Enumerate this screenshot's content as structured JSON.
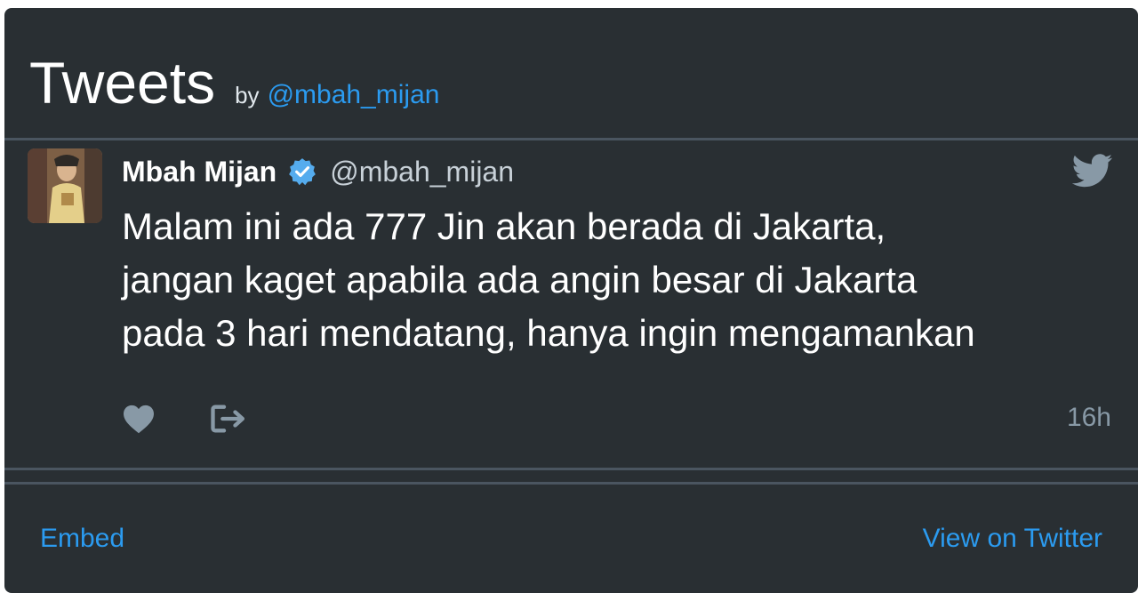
{
  "header": {
    "title": "Tweets",
    "by": "by",
    "handle": "@mbah_mijan"
  },
  "tweet": {
    "display_name": "Mbah Mijan",
    "screen_name": "@mbah_mijan",
    "text_lines": [
      "Malam ini ada 777 Jin akan berada di Jakarta,",
      "jangan kaget apabila ada angin besar di Jakarta",
      "pada 3 hari mendatang, hanya ingin mengamankan"
    ],
    "timestamp": "16h",
    "icons": {
      "verified": "verified-badge-icon",
      "bird": "twitter-bird-icon",
      "like": "heart-icon",
      "share": "share-icon"
    }
  },
  "footer": {
    "embed_label": "Embed",
    "view_label": "View on Twitter"
  },
  "colors": {
    "background": "#292f33",
    "link": "#2b9bf0",
    "text": "#ffffff",
    "muted": "#8899a6"
  }
}
